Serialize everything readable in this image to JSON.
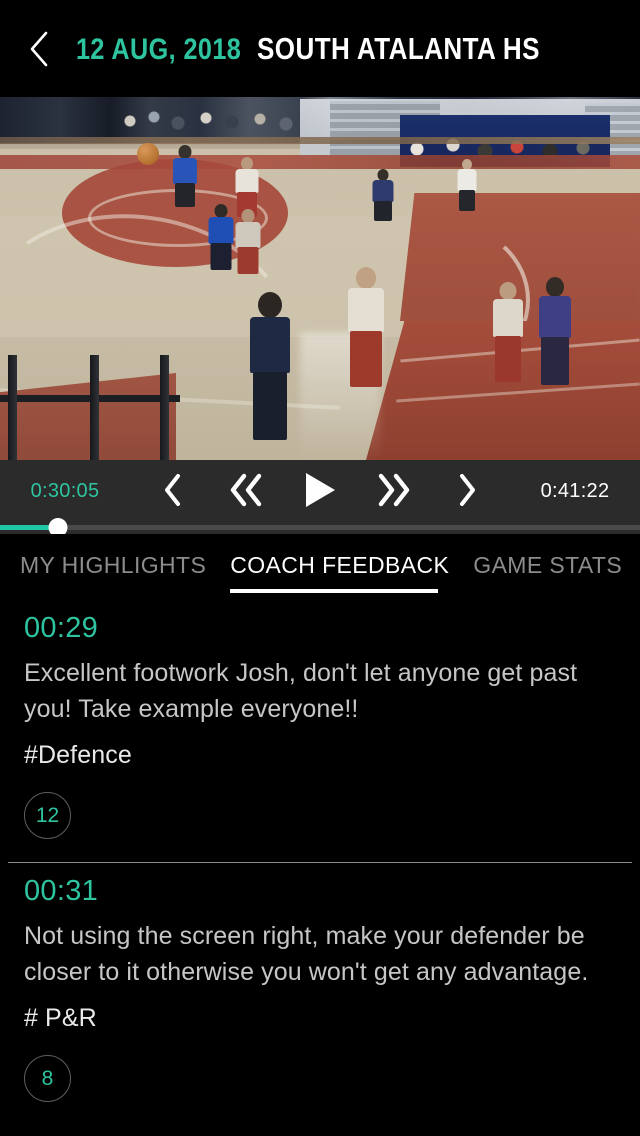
{
  "header": {
    "back_icon": "chevron-left-icon",
    "date": "12 AUG, 2018",
    "team": "SOUTH ATALANTA HS"
  },
  "video": {
    "description": "basketball-game-indoor-court"
  },
  "player": {
    "current_time": "0:30:05",
    "total_time": "0:41:22",
    "progress_percent": 9,
    "controls": [
      {
        "name": "step-back-button",
        "icon": "chevron-left-icon",
        "label": "‹"
      },
      {
        "name": "rewind-button",
        "icon": "double-chevron-left-icon",
        "label": "«"
      },
      {
        "name": "play-button",
        "icon": "play-icon",
        "label": "▶"
      },
      {
        "name": "fast-forward-button",
        "icon": "double-chevron-right-icon",
        "label": "»"
      },
      {
        "name": "step-forward-button",
        "icon": "chevron-right-icon",
        "label": "›"
      }
    ]
  },
  "tabs": [
    {
      "label": "MY HIGHLIGHTS",
      "active": false
    },
    {
      "label": "COACH FEEDBACK",
      "active": true
    },
    {
      "label": "GAME STATS",
      "active": false
    }
  ],
  "feedback": [
    {
      "time": "00:29",
      "text": "Excellent footwork Josh, don't let anyone get past you! Take example everyone!!",
      "tag": "#Defence",
      "badge": "12"
    },
    {
      "time": "00:31",
      "text": "Not using the screen right, make your defender be closer to it otherwise you won't get any advantage.",
      "tag": "# P&R",
      "badge": "8"
    }
  ],
  "colors": {
    "accent_teal": "#2ec4a0",
    "progress_teal": "#1ec8a5",
    "background": "#000000",
    "controls_bar": "#2b2b2b",
    "body_text": "#c6c6c6",
    "inactive_tab": "#8c8c8c"
  }
}
